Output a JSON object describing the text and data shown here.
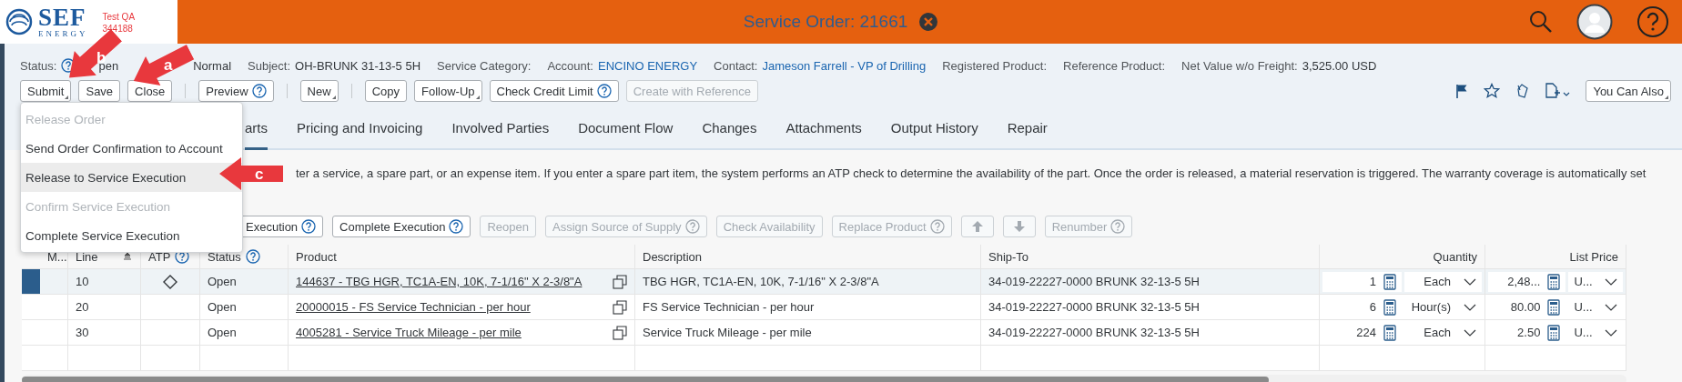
{
  "header": {
    "logo_name": "SEF",
    "logo_tagline": "ENERGY",
    "environment": "Test QA",
    "environment_number": "344188",
    "title": "Service Order: 21661"
  },
  "summary": [
    {
      "kind": "help",
      "label": "Status:",
      "value": "pen"
    },
    {
      "kind": "text",
      "value": "Normal"
    },
    {
      "kind": "text",
      "label": "Subject:",
      "value": "OH-BRUNK 31-13-5 5H"
    },
    {
      "kind": "text",
      "label": "Service Category:"
    },
    {
      "kind": "link",
      "label": "Account:",
      "value": "ENCINO ENERGY"
    },
    {
      "kind": "link",
      "label": "Contact:",
      "value": "Jameson Farrell - VP of Drilling"
    },
    {
      "kind": "text",
      "label": "Registered Product:"
    },
    {
      "kind": "text",
      "label": "Reference Product:"
    },
    {
      "kind": "text",
      "label": "Net Value w/o Freight:",
      "value": "3,525.00 USD"
    }
  ],
  "actions": [
    {
      "kind": "button",
      "label": "Submit",
      "menu": true,
      "help": false,
      "disabled": false
    },
    {
      "kind": "button",
      "label": "Save",
      "menu": false,
      "help": false,
      "disabled": false
    },
    {
      "kind": "button",
      "label": "Close",
      "menu": false,
      "help": false,
      "disabled": false
    },
    {
      "kind": "separator"
    },
    {
      "kind": "button",
      "label": "Preview",
      "menu": false,
      "help": true,
      "disabled": false
    },
    {
      "kind": "separator"
    },
    {
      "kind": "button",
      "label": "New",
      "menu": true,
      "help": false,
      "disabled": false
    },
    {
      "kind": "separator"
    },
    {
      "kind": "button",
      "label": "Copy",
      "menu": false,
      "help": false,
      "disabled": false
    },
    {
      "kind": "button",
      "label": "Follow-Up",
      "menu": true,
      "help": false,
      "disabled": false
    },
    {
      "kind": "button",
      "label": "Check Credit Limit",
      "menu": false,
      "help": true,
      "disabled": false
    },
    {
      "kind": "button",
      "label": "Create with Reference",
      "menu": false,
      "help": false,
      "disabled": true
    }
  ],
  "more_button": {
    "label": "You Can Also",
    "menu": true
  },
  "action_menu": [
    {
      "label": "Release Order",
      "disabled": true,
      "highlighted": false
    },
    {
      "label": "Send Order Confirmation to Account",
      "disabled": false,
      "highlighted": false
    },
    {
      "label": "Release to Service Execution",
      "disabled": false,
      "highlighted": true
    },
    {
      "label": "Confirm Service Execution",
      "disabled": true,
      "highlighted": false
    },
    {
      "label": "Complete Service Execution",
      "disabled": false,
      "highlighted": false
    }
  ],
  "tabs": [
    {
      "label": "arts",
      "selected": true
    },
    {
      "label": "Pricing and Invoicing",
      "selected": false
    },
    {
      "label": "Involved Parties",
      "selected": false
    },
    {
      "label": "Document Flow",
      "selected": false
    },
    {
      "label": "Changes",
      "selected": false
    },
    {
      "label": "Attachments",
      "selected": false
    },
    {
      "label": "Output History",
      "selected": false
    },
    {
      "label": "Repair",
      "selected": false
    }
  ],
  "info_text": "ter a service, a spare part, or an expense item. If you enter a spare part item, the system performs an ATP check to determine the availability of the part. Once the order is released, a material reservation is triggered. The warranty coverage is automatically set",
  "item_actions": [
    {
      "kind": "text",
      "label": "Execution",
      "help": true,
      "disabled": false
    },
    {
      "kind": "text",
      "label": "Complete Execution",
      "help": true,
      "disabled": false
    },
    {
      "kind": "text",
      "label": "Reopen",
      "help": false,
      "disabled": true
    },
    {
      "kind": "text",
      "label": "Assign Source of Supply",
      "help": true,
      "disabled": true
    },
    {
      "kind": "text",
      "label": "Check Availability",
      "help": false,
      "disabled": true
    },
    {
      "kind": "text",
      "label": "Replace Product",
      "help": true,
      "disabled": true
    },
    {
      "kind": "up",
      "disabled": true
    },
    {
      "kind": "down",
      "disabled": true
    },
    {
      "kind": "text",
      "label": "Renumber",
      "help": true,
      "disabled": true
    }
  ],
  "table": {
    "columns": [
      {
        "kind": "plain",
        "label": "M..."
      },
      {
        "kind": "sort",
        "label": "Line"
      },
      {
        "kind": "help",
        "label": "ATP"
      },
      {
        "kind": "help",
        "label": "Status"
      },
      {
        "kind": "plain",
        "label": "Product"
      },
      {
        "kind": "plain",
        "label": "Description"
      },
      {
        "kind": "plain",
        "label": "Ship-To"
      },
      {
        "kind": "plain",
        "label": "Quantity"
      },
      {
        "kind": "plain",
        "label": "List Price"
      }
    ],
    "rows": [
      {
        "selected": true,
        "line": "10",
        "atp_marker": true,
        "status": "Open",
        "product": "144637 - TBG HGR, TC1A-EN, 10K, 7-1/16\" X 2-3/8\"A",
        "description": "TBG HGR, TC1A-EN, 10K, 7-1/16\" X 2-3/8\"A",
        "ship_to": "34-019-22227-0000 BRUNK 32-13-5 5H",
        "quantity": "1",
        "unit": "Each",
        "list_price": "2,48...",
        "price_unit": "U..."
      },
      {
        "selected": false,
        "line": "20",
        "atp_marker": false,
        "status": "Open",
        "product": "20000015 - FS Service Technician - per hour",
        "description": "FS Service Technician - per hour",
        "ship_to": "34-019-22227-0000 BRUNK 32-13-5 5H",
        "quantity": "6",
        "unit": "Hour(s)",
        "list_price": "80.00",
        "price_unit": "U..."
      },
      {
        "selected": false,
        "line": "30",
        "atp_marker": false,
        "status": "Open",
        "product": "4005281 - Service Truck Mileage - per mile",
        "description": "Service Truck Mileage - per mile",
        "ship_to": "34-019-22227-0000 BRUNK 32-13-5 5H",
        "quantity": "224",
        "unit": "Each",
        "list_price": "2.50",
        "price_unit": "U..."
      }
    ]
  },
  "annotations": [
    {
      "label": "b"
    },
    {
      "label": "a"
    },
    {
      "label": "c"
    }
  ]
}
